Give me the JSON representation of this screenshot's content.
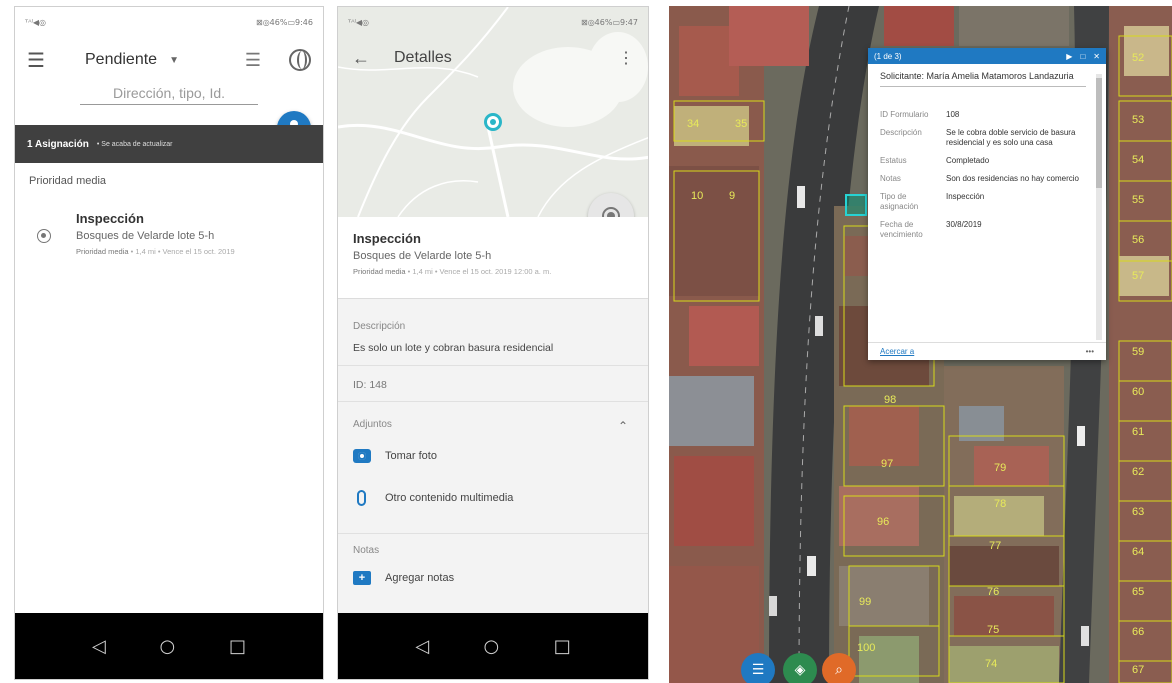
{
  "status_bar": {
    "p1_left": "ᵀᴬˡ◀◎",
    "p1_right": "⊠◎46%▭9:46",
    "p2_left": "ᵀᴬˡ◀◎",
    "p2_right": "⊠◎46%▭9:47"
  },
  "phone1": {
    "filter_label": "Pendiente",
    "search_placeholder": "Dirección, tipo, Id.",
    "bar_count": "1 Asignación",
    "bar_sub": "• Se acaba de actualizar",
    "section": "Prioridad media",
    "item": {
      "title": "Inspección",
      "address": "Bosques de Velarde lote 5-h",
      "meta_priority": "Prioridad media",
      "meta_rest": "• 1,4 mi • Vence el 15 oct. 2019"
    }
  },
  "phone2": {
    "title": "Detalles",
    "item": {
      "title": "Inspección",
      "address": "Bosques de Velarde lote 5-h",
      "meta_priority": "Prioridad media",
      "meta_rest": "• 1,4 mi • Vence el 15 oct. 2019 12:00 a. m."
    },
    "description_label": "Descripción",
    "description_value": "Es solo un lote y cobran basura residencial",
    "id_text": "ID: 148",
    "attachments_label": "Adjuntos",
    "take_photo": "Tomar foto",
    "other_media": "Otro contenido multimedia",
    "notes_label": "Notas",
    "add_notes": "Agregar notas"
  },
  "map": {
    "popup": {
      "count": "(1 de 3)",
      "title": "Solicitante: María Amelia Matamoros Landazuria",
      "rows": [
        {
          "k": "ID Formulario",
          "v": "108"
        },
        {
          "k": "Descripción",
          "v": "Se le cobra doble servicio de basura residencial y es solo una casa"
        },
        {
          "k": "Estatus",
          "v": "Completado"
        },
        {
          "k": "Notas",
          "v": "Son dos residencias no hay comercio"
        },
        {
          "k": "Tipo de asignación",
          "v": "Inspección"
        },
        {
          "k": "Fecha de vencimiento",
          "v": "30/8/2019"
        }
      ],
      "zoom_to": "Acercar a",
      "more": "•••"
    },
    "parcels": [
      "52",
      "53",
      "54",
      "55",
      "56",
      "57",
      "59",
      "60",
      "61",
      "62",
      "63",
      "64",
      "65",
      "66",
      "67",
      "34",
      "35",
      "10",
      "9",
      "79",
      "78",
      "77",
      "76",
      "75",
      "74",
      "97",
      "96",
      "100",
      "99",
      "98"
    ]
  }
}
